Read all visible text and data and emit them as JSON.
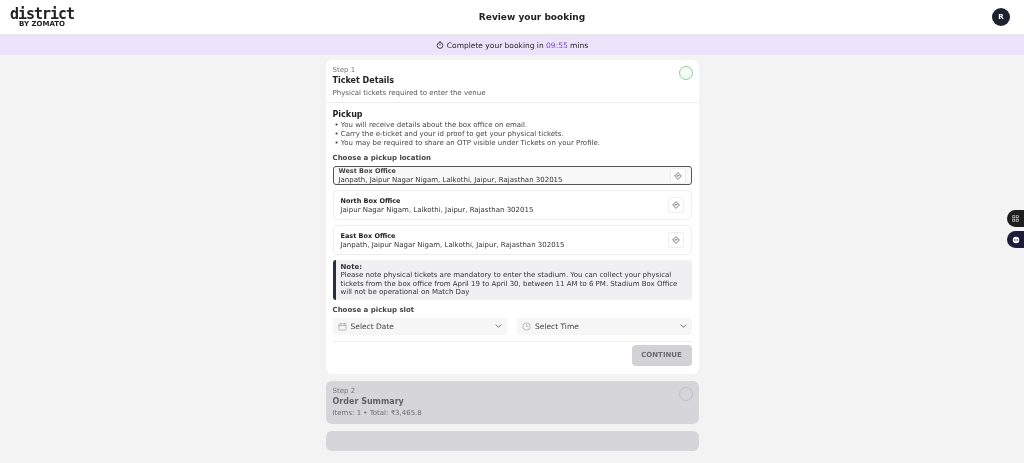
{
  "header": {
    "logo": "district",
    "logo_sub": "BY ZOMATO",
    "title": "Review your booking",
    "avatar": "R"
  },
  "timer": {
    "prefix": "Complete your booking in",
    "time": "09:55",
    "suffix": "mins"
  },
  "steps": [
    {
      "step": "Step 1",
      "title": "Ticket Details",
      "subtitle": "Physical tickets required to enter the venue",
      "disabled": false,
      "pickup": {
        "heading": "Pickup",
        "bullets": [
          "• You will receive details about the box office on email.",
          "• Carry the e-ticket and your id proof to get your physical tickets.",
          "• You may be required to share an OTP visible under Tickets on your Profile."
        ],
        "location_label": "Choose a pickup location",
        "locations": [
          {
            "name": "West Box Office",
            "address": "Janpath, Jaipur Nagar Nigam, Lalkothi, Jaipur, Rajasthan 302015",
            "selected": true
          },
          {
            "name": "North Box Office",
            "address": "Jaipur Nagar Nigam, Lalkothi, Jaipur, Rajasthan 302015",
            "selected": false
          },
          {
            "name": "East Box Office",
            "address": "Janpath, Jaipur Nagar Nigam, Lalkothi, Jaipur, Rajasthan 302015",
            "selected": false
          }
        ],
        "note": {
          "title": "Note:",
          "text": "Please note physical tickets are mandatory to enter the stadium. You can collect your physical tickets from the box office from April 19 to April 30, between 11 AM to 6 PM. Stadium Box Office will not be operational on Match Day"
        },
        "slot_label": "Choose a pickup slot",
        "date_placeholder": "Select Date",
        "time_placeholder": "Select Time",
        "continue": {
          "label": "CONTINUE",
          "disabled": true
        }
      }
    },
    {
      "step": "Step 2",
      "title": "Order Summary",
      "subtitle": "Items: 1 • Total: ₹3,465.8",
      "disabled": true
    },
    {
      "disabled": true
    }
  ]
}
